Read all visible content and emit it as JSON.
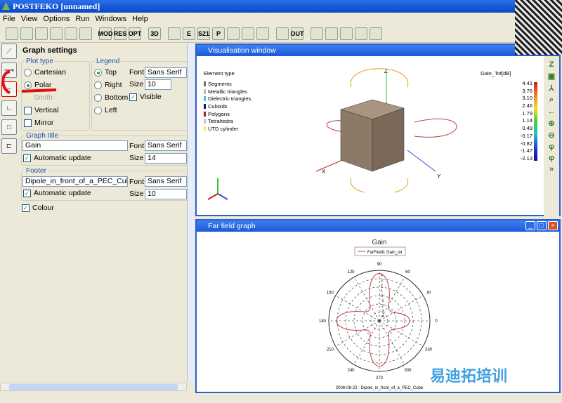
{
  "app": {
    "title": "POSTFEKO [unnamed]"
  },
  "menu": [
    "File",
    "View",
    "Options",
    "Run",
    "Windows",
    "Help"
  ],
  "toolbar": {
    "icons": [
      "new-icon",
      "open-icon",
      "save-icon",
      "save-as-icon",
      "print-icon",
      "camera-icon",
      "open-model-icon",
      "open-results-icon",
      "open-optimisation-icon",
      "3d-view-icon",
      "graph-icon",
      "e-field-icon",
      "s-parameter-icon",
      "power-icon",
      "cartesian-graph-icon",
      "polar-graph-icon",
      "surface-graph-icon",
      "smith-icon",
      "open-output-icon",
      "current-icon",
      "field-icon",
      "near-field-icon",
      "table-icon",
      "target-icon"
    ],
    "labels": {
      "open-model-icon": "MOD",
      "open-results-icon": "RES",
      "open-optimisation-icon": "OPT",
      "3d-view-icon": "3D",
      "e-field-icon": "E",
      "s-parameter-icon": "S21",
      "power-icon": "P",
      "open-output-icon": "OUT"
    }
  },
  "graph_settings": {
    "title": "Graph settings",
    "plot_type": {
      "legend": "Plot type",
      "options": [
        "Cartesian",
        "Polar",
        "Smith"
      ],
      "selected": "Polar",
      "vertical_label": "Vertical",
      "vertical": false,
      "mirror_label": "Mirror",
      "mirror": false
    },
    "legend": {
      "legend": "Legend",
      "positions": [
        "Top",
        "Right",
        "Bottom",
        "Left"
      ],
      "selected": "Top",
      "font_label": "Font",
      "font": "Sans Serif",
      "size_label": "Size",
      "size": "10",
      "visible_label": "Visible",
      "visible": true
    },
    "graph_title": {
      "legend": "Graph title",
      "value": "Gain",
      "font_label": "Font",
      "font": "Sans Serif",
      "size_label": "Size",
      "size": "14",
      "auto_label": "Automatic update",
      "auto": true
    },
    "footer": {
      "legend": "Footer",
      "value": "Dipole_in_front_of_a_PEC_Cube",
      "font_label": "Font",
      "font": "Sans Serif",
      "size_label": "Size",
      "size": "10",
      "auto_label": "Automatic update",
      "auto": true
    },
    "colour_label": "Colour",
    "colour": true
  },
  "vis": {
    "title": "Visualisation window",
    "element_type_title": "Element type",
    "elements": [
      {
        "name": "Segments",
        "color": "#707070"
      },
      {
        "name": "Metallic triangles",
        "color": "#c0b8b0"
      },
      {
        "name": "Dielectric triangles",
        "color": "#40d0c0"
      },
      {
        "name": "Cuboids",
        "color": "#10108a"
      },
      {
        "name": "Polygons",
        "color": "#a02020"
      },
      {
        "name": "Tetrahedra",
        "color": "#d8c0d8"
      },
      {
        "name": "UTD cylinder",
        "color": "#f0f060"
      }
    ],
    "colorbar_title": "Gain_Tot[dB]",
    "colorbar_ticks": [
      "4.41",
      "3.76",
      "3.10",
      "2.46",
      "1.79",
      "1.14",
      "0.49",
      "-0.17",
      "-0.82",
      "-1.47",
      "-2.13"
    ],
    "axes": {
      "x": "X",
      "y": "Y",
      "z": "Z"
    }
  },
  "farfield": {
    "title": "Far field graph",
    "chart_data": {
      "type": "polar",
      "title": "Gain",
      "legend": [
        "FarField1 Gain_tot"
      ],
      "angle_labels": [
        "0",
        "30",
        "60",
        "90",
        "120",
        "150",
        "180",
        "210",
        "240",
        "270",
        "300",
        "330"
      ],
      "radial_labels": [
        "-4",
        "-3",
        "-2",
        "-1",
        "0",
        "1",
        "2",
        "3",
        "4"
      ],
      "series": [
        {
          "name": "FarField1 Gain_tot",
          "lobes_deg": [
            0,
            90,
            180,
            270
          ],
          "lobe_peaks_db": [
            1.0,
            4.4,
            3.5,
            4.0
          ],
          "null_db": -2.1
        }
      ],
      "footer": "2008-08-22 : Dipole_in_front_of_a_PEC_Cube"
    }
  },
  "colors": {
    "titlebar": "#0a48c8",
    "curve": "#c04040",
    "cube": "#8c7a68"
  }
}
